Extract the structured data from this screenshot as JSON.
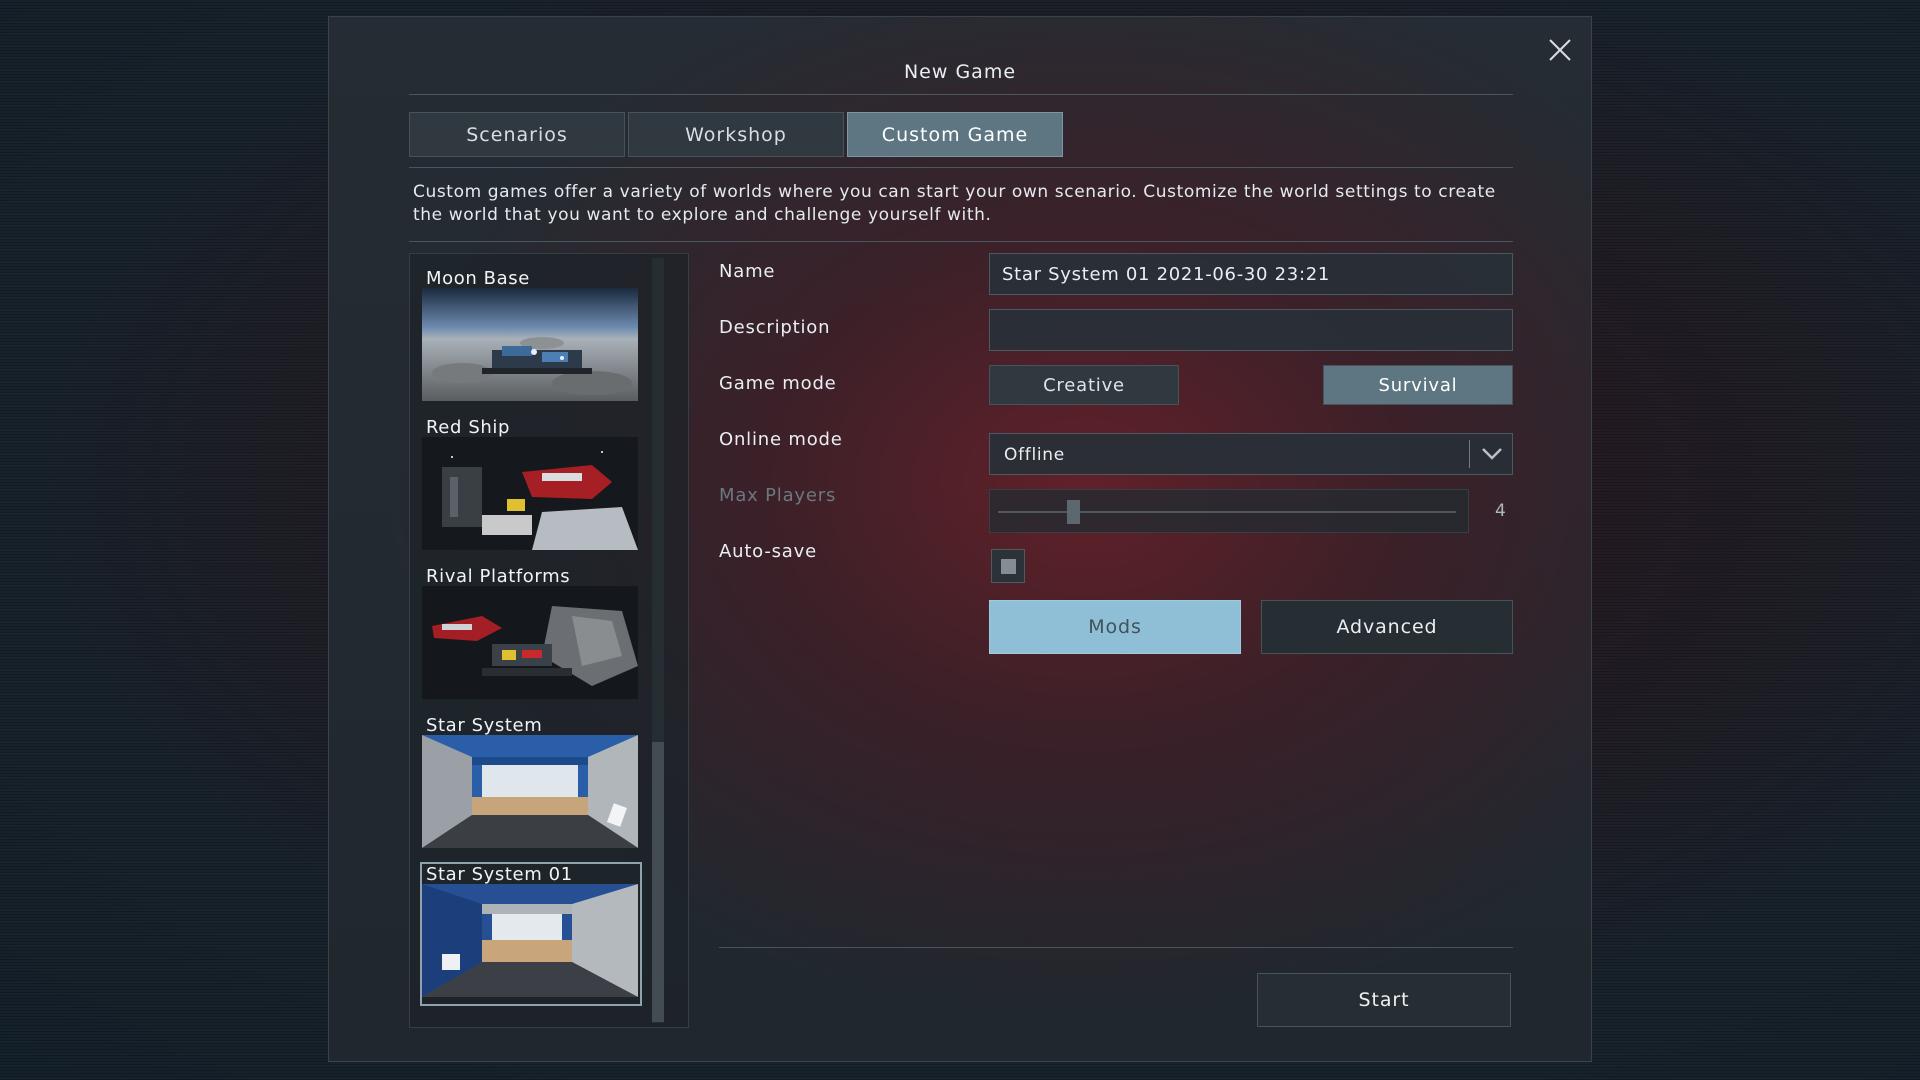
{
  "dialog": {
    "title": "New Game"
  },
  "tabs": [
    {
      "label": "Scenarios"
    },
    {
      "label": "Workshop"
    },
    {
      "label": "Custom Game"
    }
  ],
  "active_tab": "Custom Game",
  "description": "Custom games offer a variety of worlds where you can start your own scenario. Customize the world settings to create the world that you want to explore and challenge yourself with.",
  "worlds": [
    {
      "name": "Moon Base"
    },
    {
      "name": "Red Ship"
    },
    {
      "name": "Rival Platforms"
    },
    {
      "name": "Star System"
    },
    {
      "name": "Star System 01"
    }
  ],
  "selected_world": "Star System 01",
  "form": {
    "name_label": "Name",
    "name_value": "Star System 01 2021-06-30 23:21",
    "description_label": "Description",
    "description_value": "",
    "game_mode_label": "Game mode",
    "game_mode_options": [
      "Creative",
      "Survival"
    ],
    "game_mode_selected": "Survival",
    "online_mode_label": "Online mode",
    "online_mode_value": "Offline",
    "max_players_label": "Max Players",
    "max_players_value": "4",
    "autosave_label": "Auto-save"
  },
  "buttons": {
    "mods": "Mods",
    "advanced": "Advanced",
    "start": "Start"
  },
  "colors": {
    "accent_tab": "#5d7681",
    "mods_button": "#8fbfd6"
  },
  "icons": {
    "close": "close-icon",
    "dropdown": "chevron-down-icon"
  }
}
